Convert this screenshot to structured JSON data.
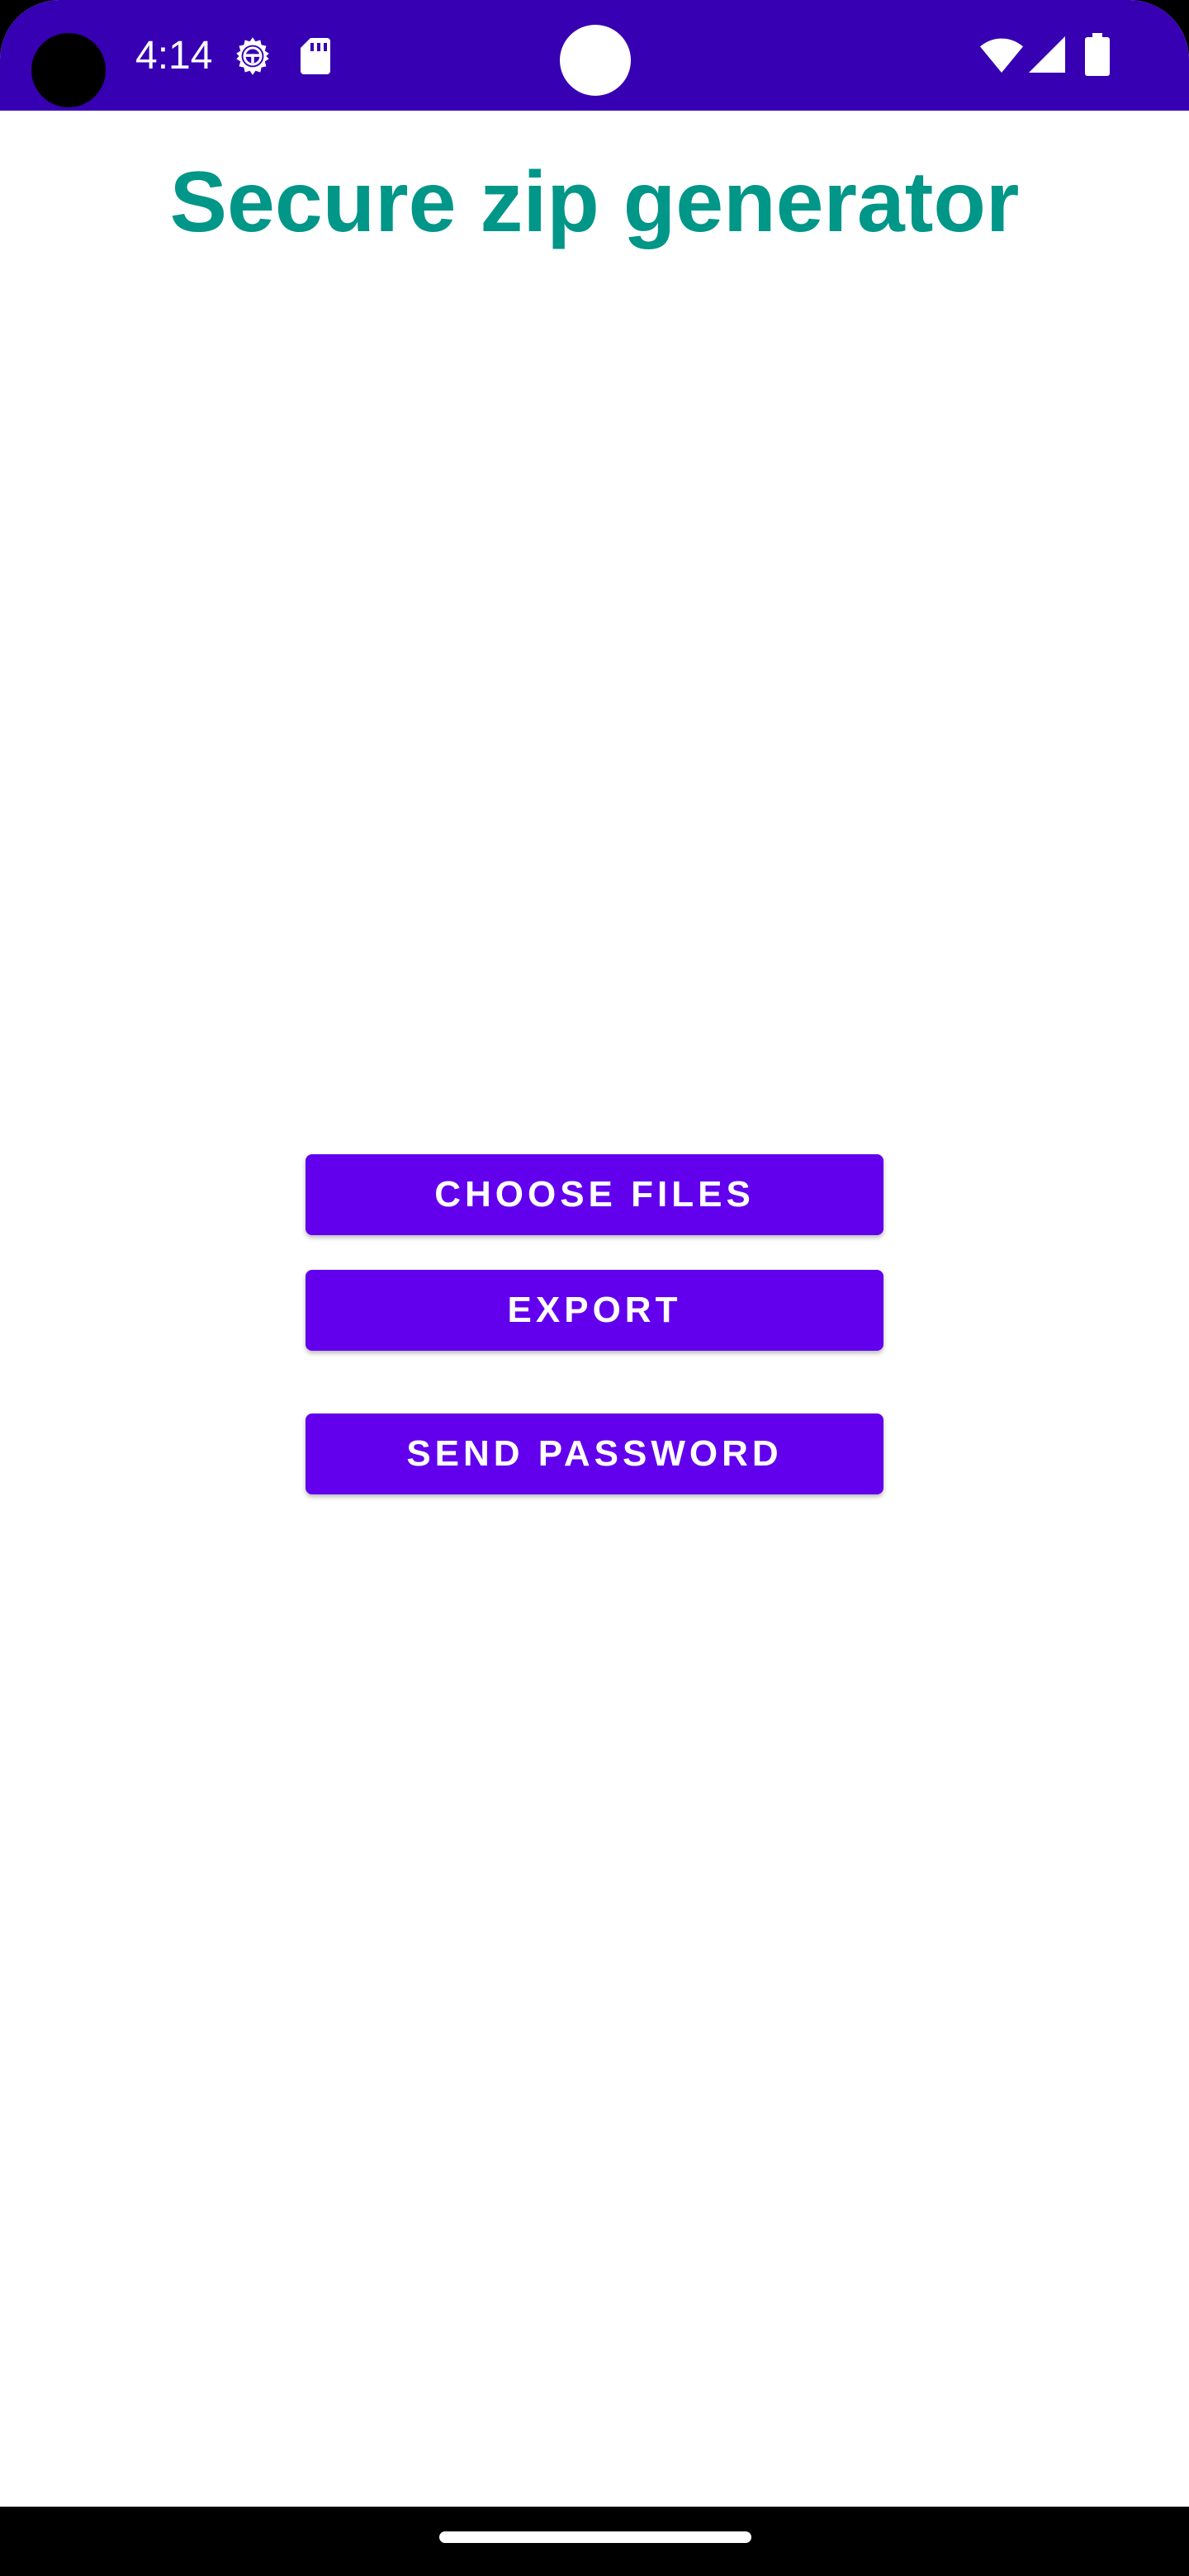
{
  "status_bar": {
    "time": "4:14",
    "background_color": "#3700b3",
    "icons": [
      "settings-gear-icon",
      "sd-card-icon",
      "wifi-icon",
      "cell-signal-icon",
      "battery-icon"
    ]
  },
  "app": {
    "title": "Secure zip generator",
    "title_color": "#009688"
  },
  "buttons": {
    "choose_files": "CHOOSE FILES",
    "export": "EXPORT",
    "send_password": "SEND PASSWORD",
    "color": "#6200ee"
  },
  "navigation": {
    "handle": "home-handle"
  }
}
